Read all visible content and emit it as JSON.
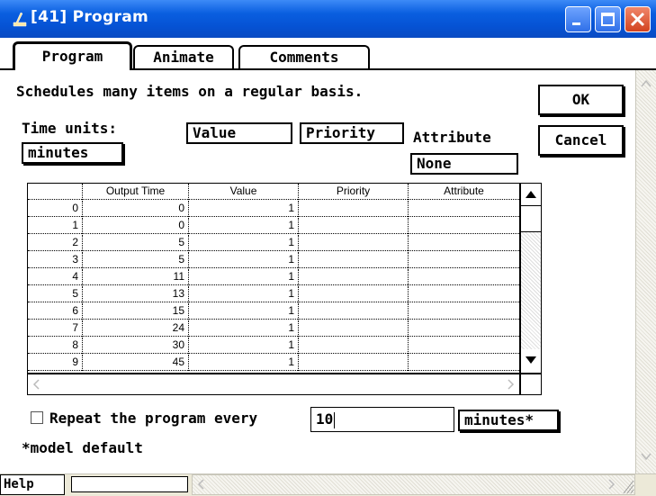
{
  "window": {
    "title": "[41]  Program"
  },
  "tabs": [
    {
      "label": "Program",
      "active": true
    },
    {
      "label": "Animate",
      "active": false
    },
    {
      "label": "Comments",
      "active": false
    }
  ],
  "description": "Schedules many items on a regular basis.",
  "time_units": {
    "label": "Time units:",
    "value": "minutes"
  },
  "columns_top": {
    "value": "Value",
    "priority": "Priority",
    "attribute_label": "Attribute",
    "attribute_value": "None"
  },
  "buttons": {
    "ok": "OK",
    "cancel": "Cancel"
  },
  "table": {
    "headers": [
      "",
      "Output Time",
      "Value",
      "Priority",
      "Attribute"
    ],
    "rows": [
      [
        "0",
        "0",
        "1",
        "",
        ""
      ],
      [
        "1",
        "0",
        "1",
        "",
        ""
      ],
      [
        "2",
        "5",
        "1",
        "",
        ""
      ],
      [
        "3",
        "5",
        "1",
        "",
        ""
      ],
      [
        "4",
        "11",
        "1",
        "",
        ""
      ],
      [
        "5",
        "13",
        "1",
        "",
        ""
      ],
      [
        "6",
        "15",
        "1",
        "",
        ""
      ],
      [
        "7",
        "24",
        "1",
        "",
        ""
      ],
      [
        "8",
        "30",
        "1",
        "",
        ""
      ],
      [
        "9",
        "45",
        "1",
        "",
        ""
      ]
    ]
  },
  "repeat": {
    "label": "Repeat the program every",
    "checked": false,
    "value": "10",
    "units": "minutes*"
  },
  "footnote": "*model default",
  "help": {
    "label": "Help"
  },
  "icons": {
    "app": "blocks-icon",
    "minimize": "minimize-icon",
    "maximize": "maximize-icon",
    "close": "close-icon"
  },
  "colors": {
    "titlebar": "#0552d4",
    "close": "#d2431f"
  }
}
